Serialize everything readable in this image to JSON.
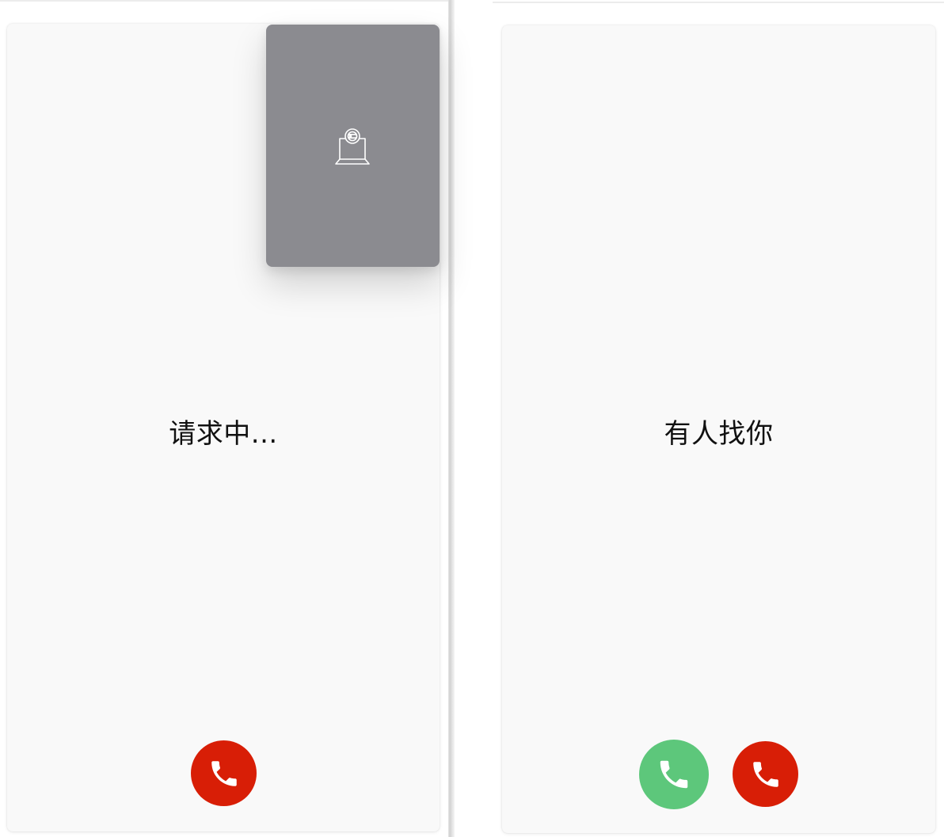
{
  "colors": {
    "page_background": "#ffffff",
    "panel_background": "#f9f9f9",
    "preview_background": "#8b8b90",
    "hangup_red": "#d81e06",
    "accept_green": "#5dc77b",
    "text": "#111111"
  },
  "caller_panel": {
    "status_text": "请求中...",
    "preview": {
      "icon": "webcam-laptop-icon"
    },
    "hangup_button": {
      "icon": "phone-handset-icon"
    }
  },
  "callee_panel": {
    "status_text": "有人找你",
    "accept_button": {
      "icon": "phone-handset-icon"
    },
    "reject_button": {
      "icon": "phone-handset-icon"
    }
  }
}
